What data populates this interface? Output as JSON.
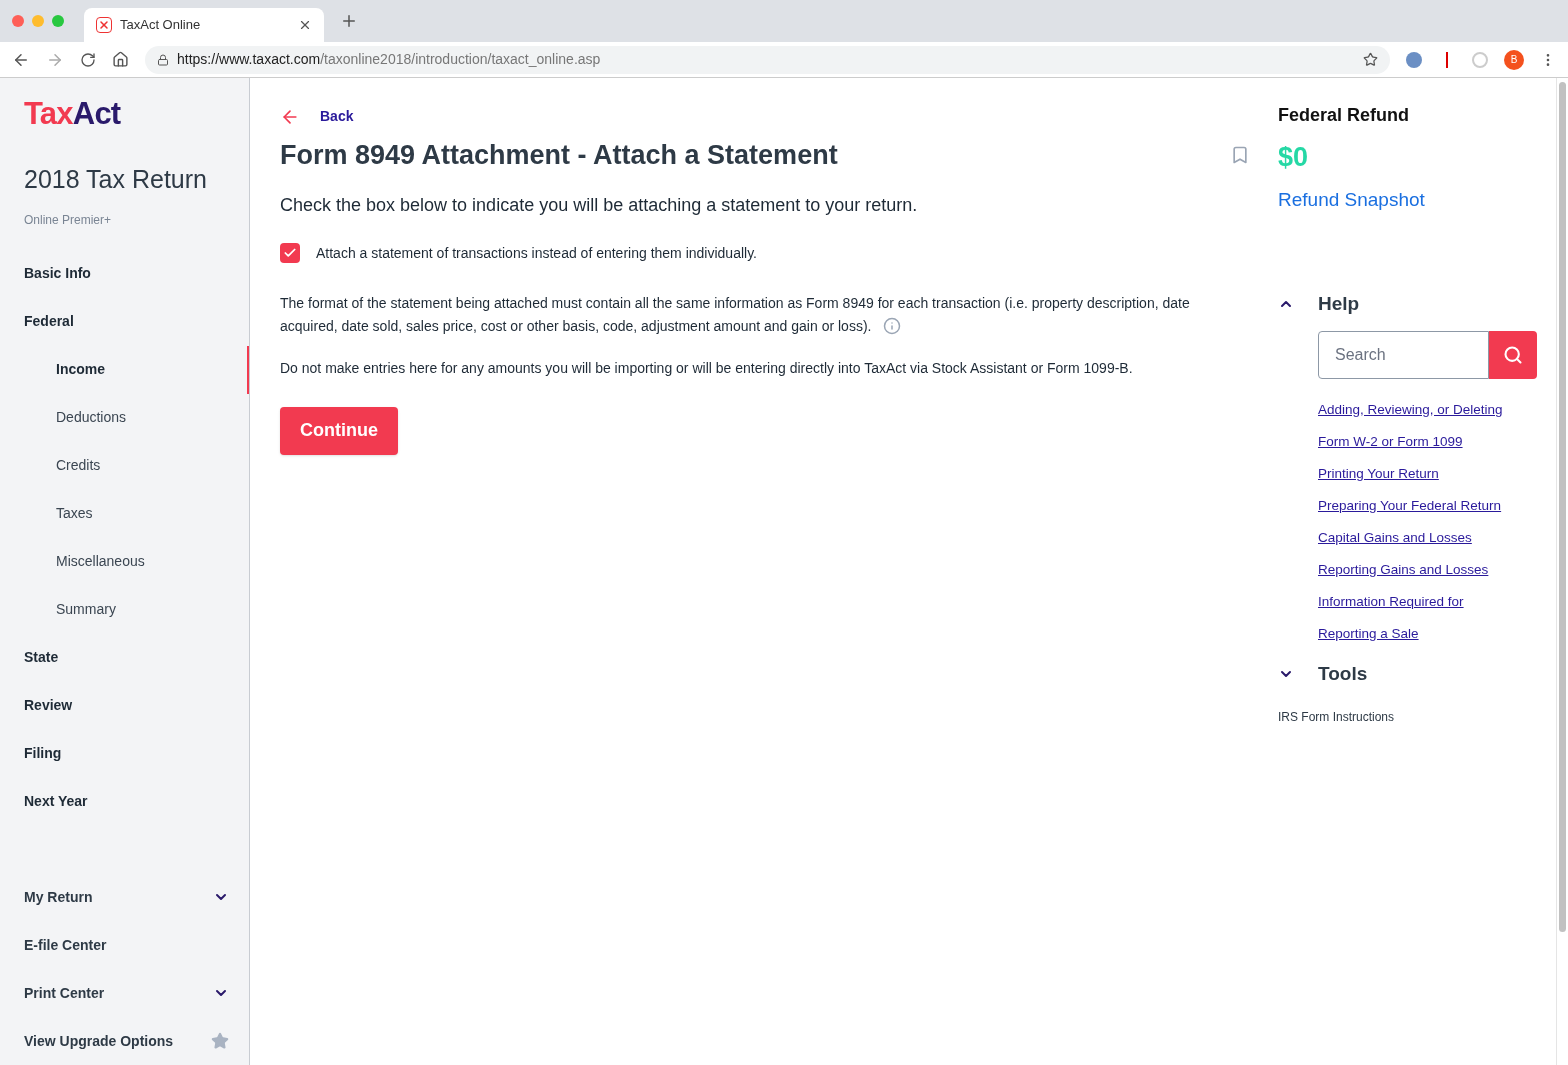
{
  "browser": {
    "tab_title": "TaxAct Online",
    "url_host": "https://www.taxact.com",
    "url_path": "/taxonline2018/introduction/taxact_online.asp",
    "profile_initial": "B"
  },
  "sidebar": {
    "logo": [
      "Tax",
      "Act"
    ],
    "title": "2018 Tax Return",
    "subtitle": "Online Premier+",
    "nav": [
      {
        "label": "Basic Info",
        "kind": "section",
        "selected": false
      },
      {
        "label": "Federal",
        "kind": "section",
        "selected": false
      },
      {
        "label": "Income",
        "kind": "sub",
        "selected": true
      },
      {
        "label": "Deductions",
        "kind": "sub",
        "selected": false
      },
      {
        "label": "Credits",
        "kind": "sub",
        "selected": false
      },
      {
        "label": "Taxes",
        "kind": "sub",
        "selected": false
      },
      {
        "label": "Miscellaneous",
        "kind": "sub",
        "selected": false
      },
      {
        "label": "Summary",
        "kind": "sub",
        "selected": false
      },
      {
        "label": "State",
        "kind": "section",
        "selected": false
      },
      {
        "label": "Review",
        "kind": "section",
        "selected": false
      },
      {
        "label": "Filing",
        "kind": "section",
        "selected": false
      },
      {
        "label": "Next Year",
        "kind": "section",
        "selected": false
      }
    ],
    "bottom": [
      {
        "label": "My Return",
        "kind": "dropdown"
      },
      {
        "label": "E-file Center",
        "kind": "plain"
      },
      {
        "label": "Print Center",
        "kind": "dropdown"
      },
      {
        "label": "View Upgrade Options",
        "kind": "star"
      }
    ]
  },
  "main": {
    "back": "Back",
    "title": "Form 8949 Attachment - Attach a Statement",
    "instruction": "Check the box below to indicate you will be attaching a statement to your return.",
    "checkbox": {
      "label": "Attach a statement of transactions instead of entering them individually.",
      "checked": true
    },
    "paragraphs": [
      "The format of the statement being attached must contain all the same information as Form 8949 for each transaction (i.e. property description, date acquired, date sold, sales price, cost or other basis, code, adjustment amount and gain or loss).",
      "Do not make entries here for any amounts you will be importing or will be entering directly into TaxAct via Stock Assistant or Form 1099-B."
    ],
    "continue": "Continue"
  },
  "right": {
    "refund_label": "Federal Refund",
    "refund_amount": "$0",
    "snapshot_link": "Refund Snapshot",
    "help": {
      "title": "Help",
      "expanded": true,
      "search_placeholder": "Search",
      "links": [
        "Adding, Reviewing, or Deleting",
        "Form W-2 or Form 1099",
        "Printing Your Return",
        "Preparing Your Federal Return",
        "Capital Gains and Losses",
        "Reporting Gains and Losses",
        "Information Required for",
        "Reporting a Sale"
      ]
    },
    "tools": {
      "title": "Tools",
      "expanded": false,
      "items": [
        "IRS Form Instructions"
      ]
    }
  }
}
